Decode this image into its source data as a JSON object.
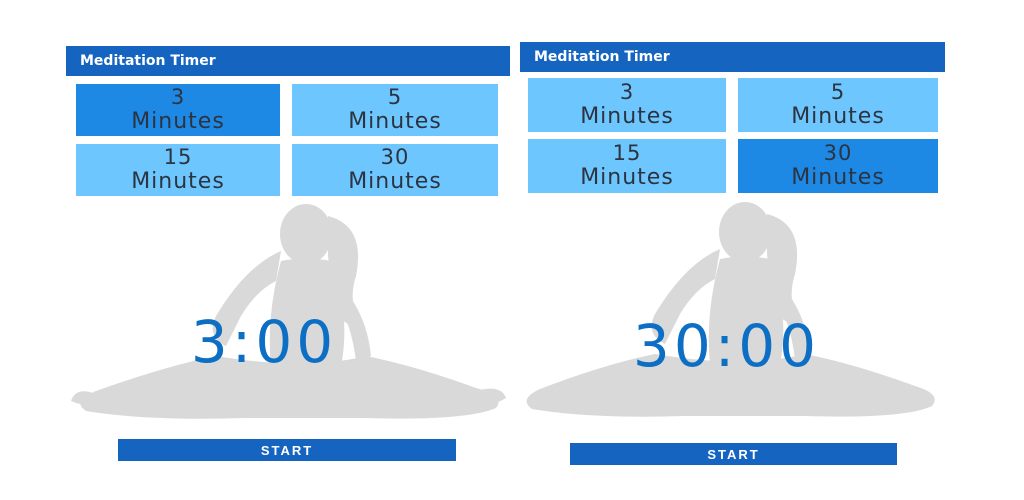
{
  "colors": {
    "appbar": "#1565c0",
    "tile_default": "#6ec6ff",
    "tile_selected": "#1e88e5",
    "time_text": "#0d6fc4",
    "silhouette": "#d9d9d9"
  },
  "screens": [
    {
      "app_title": "Meditation Timer",
      "tiles": [
        {
          "number": "3",
          "unit": "Minutes",
          "selected": true
        },
        {
          "number": "5",
          "unit": "Minutes",
          "selected": false
        },
        {
          "number": "15",
          "unit": "Minutes",
          "selected": false
        },
        {
          "number": "30",
          "unit": "Minutes",
          "selected": false
        }
      ],
      "time": "3:00",
      "start_label": "START",
      "background_icon": "meditation-silhouette-icon"
    },
    {
      "app_title": "Meditation Timer",
      "tiles": [
        {
          "number": "3",
          "unit": "Minutes",
          "selected": false
        },
        {
          "number": "5",
          "unit": "Minutes",
          "selected": false
        },
        {
          "number": "15",
          "unit": "Minutes",
          "selected": false
        },
        {
          "number": "30",
          "unit": "Minutes",
          "selected": true
        }
      ],
      "time": "30:00",
      "start_label": "START",
      "background_icon": "meditation-silhouette-icon"
    }
  ]
}
